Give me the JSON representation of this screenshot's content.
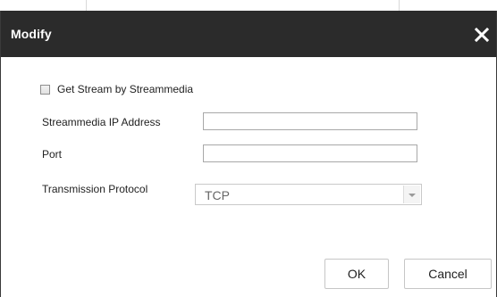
{
  "dialog": {
    "title": "Modify",
    "close_icon": "close-icon"
  },
  "form": {
    "stream_checkbox": {
      "label": "Get Stream by Streammedia",
      "checked": false
    },
    "ip_address": {
      "label": "Streammedia IP Address",
      "value": ""
    },
    "port": {
      "label": "Port",
      "value": ""
    },
    "protocol": {
      "label": "Transmission Protocol",
      "value": "TCP"
    }
  },
  "buttons": {
    "ok": "OK",
    "cancel": "Cancel"
  },
  "colors": {
    "titlebar": "#2b2b2b",
    "titlebar_text": "#ffffff",
    "border": "#a8a8a8"
  }
}
